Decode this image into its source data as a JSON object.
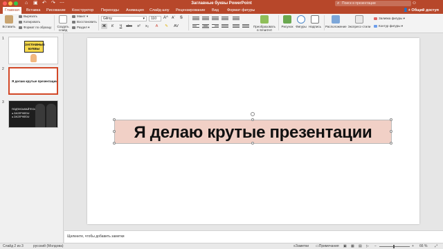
{
  "title_bar": {
    "doc_title": "Заглавные буквы PowerPoint",
    "search_placeholder": "Поиск в презентации"
  },
  "tabs": [
    {
      "label": "Главная",
      "active": true
    },
    {
      "label": "Вставка"
    },
    {
      "label": "Рисование"
    },
    {
      "label": "Конструктор"
    },
    {
      "label": "Переходы"
    },
    {
      "label": "Анимация"
    },
    {
      "label": "Слайд-шоу"
    },
    {
      "label": "Рецензирование"
    },
    {
      "label": "Вид"
    },
    {
      "label": "Формат фигуры"
    }
  ],
  "share_label": "Общий доступ",
  "ribbon": {
    "paste": "Вставить",
    "cut": "Вырезать",
    "copy": "Копировать",
    "format_painter": "Формат по образцу",
    "new_slide": "Создать слайд",
    "layout": "Макет",
    "reset": "Восстановить",
    "section": "Раздел",
    "font_name": "Gilroy",
    "font_size": "110",
    "smartart": "Преобразовать в SmartArt",
    "picture": "Рисунок",
    "shapes": "Фигуры",
    "textbox": "Надпись",
    "arrange": "Расположение",
    "quick_styles": "Экспресс-стили",
    "shape_fill": "Заливка фигуры",
    "shape_outline": "Контур фигуры"
  },
  "slides_pane": [
    {
      "number": "1",
      "text": "ЗАГЛАВНЫЕ БУКВЫ"
    },
    {
      "number": "2",
      "text": "Я делаю крутые презентации"
    },
    {
      "number": "3",
      "lines": [
        "ПОДПИСЫВАЙТЕСЬ",
        "● ZACEPIKEDU",
        "● ZACEPIKEDU"
      ]
    }
  ],
  "slide": {
    "text": "Я делаю крутые презентации",
    "shape_fill": "#f1d0c6"
  },
  "notes_placeholder": "Щелкните, чтобы добавить заметки",
  "status": {
    "slide_info": "Слайд 2 из 3",
    "language": "русский (Молдова)",
    "notes": "Заметки",
    "comments": "Примечания",
    "zoom": "66 %"
  },
  "colors": {
    "accent": "#b7472a",
    "selection": "#d24726"
  }
}
